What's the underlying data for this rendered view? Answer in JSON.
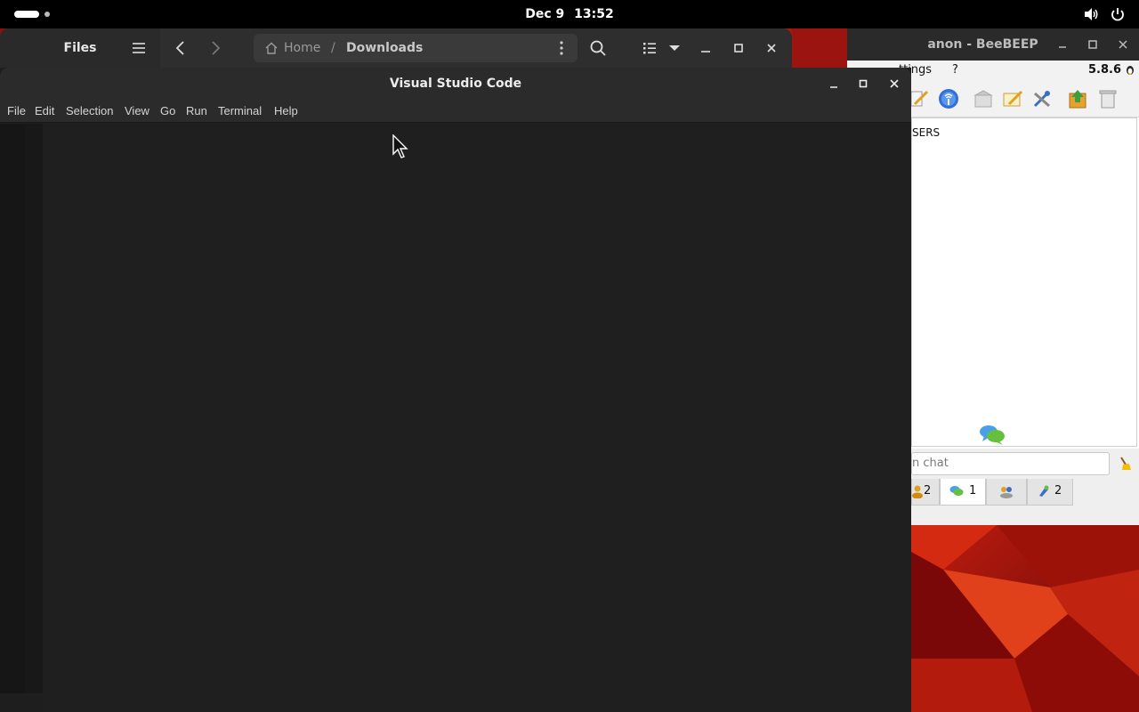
{
  "topbar": {
    "date": "Dec 9",
    "time": "13:52"
  },
  "files_window": {
    "title": "Files",
    "path_home": "Home",
    "path_separator": "/",
    "path_current": "Downloads"
  },
  "vscode_window": {
    "title": "Visual Studio Code",
    "menu": [
      "File",
      "Edit",
      "Selection",
      "View",
      "Go",
      "Run",
      "Terminal",
      "Help"
    ]
  },
  "beebeep_window": {
    "title": "anon - BeeBEEP",
    "menu_settings": "ttings",
    "menu_help": "?",
    "version": "5.8.6",
    "users_label": "SERS",
    "chat_placeholder": "n chat",
    "tabs": [
      {
        "count": "2"
      },
      {
        "count": "1"
      },
      {
        "count": ""
      },
      {
        "count": "2"
      }
    ]
  },
  "colors": {
    "vscode_bg": "#1e1e1e",
    "topbar_bg": "#000000",
    "wallpaper_red": "#c42010"
  }
}
